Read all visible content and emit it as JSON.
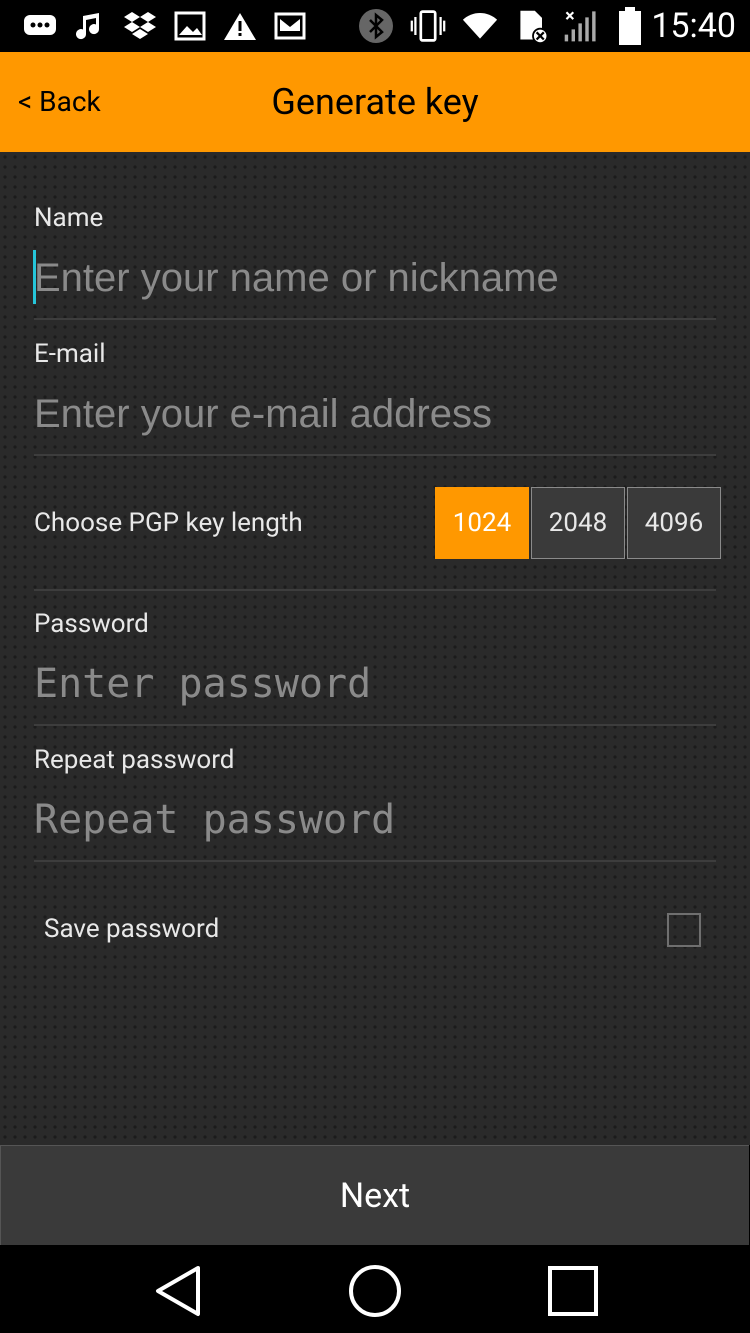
{
  "status_bar": {
    "time": "15:40",
    "icons": [
      "message-icon",
      "music-icon",
      "dropbox-icon",
      "image-icon",
      "warning-icon",
      "mail-icon",
      "bluetooth-icon",
      "vibrate-icon",
      "wifi-icon",
      "sim-icon",
      "signal-icon",
      "battery-icon"
    ]
  },
  "app_bar": {
    "back_label": "< Back",
    "title": "Generate key"
  },
  "form": {
    "name_label": "Name",
    "name_placeholder": "Enter your name or nickname",
    "email_label": "E-mail",
    "email_placeholder": "Enter your e-mail address",
    "key_length_label": "Choose PGP key length",
    "key_length_options": [
      "1024",
      "2048",
      "4096"
    ],
    "key_length_selected": "1024",
    "password_label": "Password",
    "password_placeholder": "Enter password",
    "repeat_password_label": "Repeat password",
    "repeat_password_placeholder": "Repeat password",
    "save_password_label": "Save password",
    "save_password_checked": false
  },
  "next_label": "Next",
  "colors": {
    "accent": "#FF9800",
    "background": "#2a2a2a",
    "text": "#e8e8e8",
    "placeholder": "#8a8a8a",
    "cursor": "#26c6da"
  }
}
